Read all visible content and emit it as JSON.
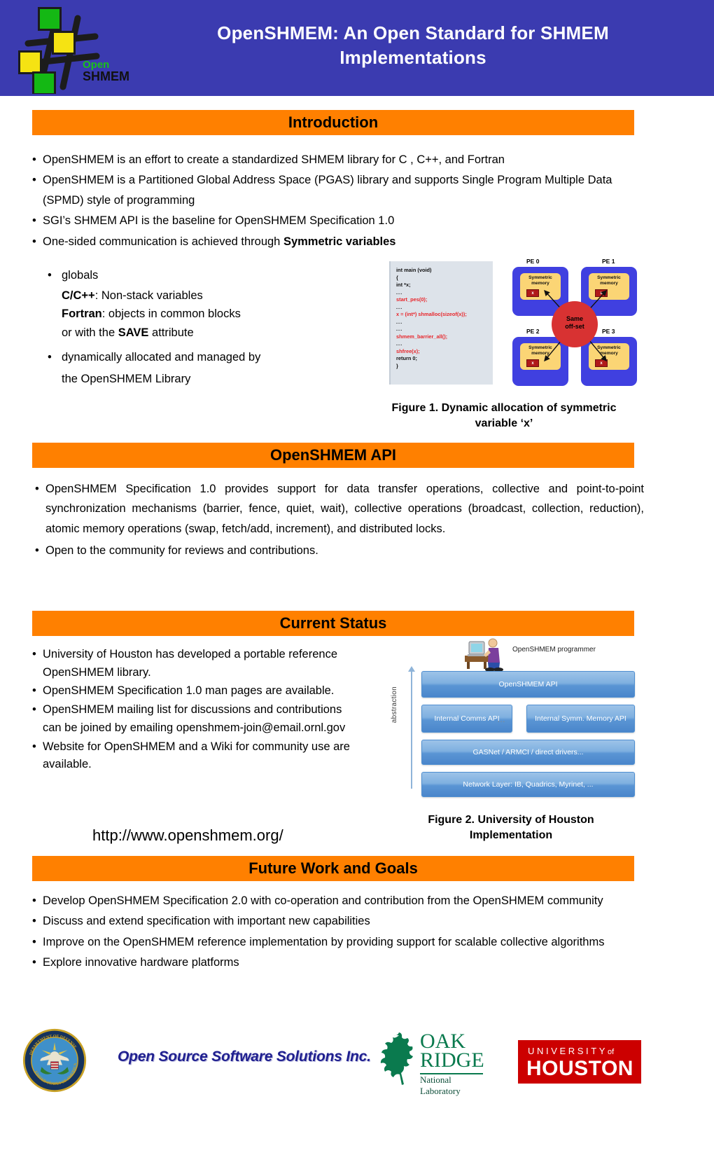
{
  "header": {
    "title_line1": "OpenSHMEM: An Open Standard for SHMEM",
    "title_line2": "Implementations",
    "logo": {
      "word_open": "Open",
      "word_shmem": "SHMEM"
    },
    "background_color": "#3b3bb0"
  },
  "accent_color": "#ff8000",
  "sections": {
    "introduction": {
      "banner": "Introduction",
      "bullets": [
        "OpenSHMEM is an effort to create a standardized SHMEM library for C , C++, and Fortran",
        "OpenSHMEM is a Partitioned Global Address Space (PGAS) library and supports Single Program Multiple Data (SPMD) style of programming",
        "SGI’s SHMEM API is the baseline for OpenSHMEM Specification 1.0"
      ],
      "bullet4_prefix": "One-sided communication is achieved through ",
      "bullet4_bold": "Symmetric variables",
      "sub": {
        "item1": "globals",
        "line_cc_bold": "C/C++",
        "line_cc_rest": ":  Non-stack variables",
        "line_fortran_bold": "Fortran",
        "line_fortran_rest": ": objects in common blocks",
        "line_save_pre": "or with the ",
        "line_save_bold": "SAVE",
        "line_save_post": " attribute",
        "item2_line1": "dynamically allocated and managed by",
        "item2_line2": "the OpenSHMEM Library"
      }
    },
    "api": {
      "banner": "OpenSHMEM API",
      "bullets": [
        "OpenSHMEM Specification 1.0 provides support for data transfer operations, collective and point-to-point synchronization mechanisms (barrier, fence, quiet, wait),    collective operations (broadcast, collection, reduction), atomic memory operations (swap, fetch/add, increment), and distributed locks.",
        "Open to the community for reviews and contributions."
      ]
    },
    "status": {
      "banner": "Current Status",
      "bullets": [
        "University of Houston has developed a portable reference OpenSHMEM library.",
        "OpenSHMEM Specification 1.0 man pages are available.",
        "OpenSHMEM mailing list  for discussions and contributions can be joined by emailing openshmem-join@email.ornl.gov",
        "Website for OpenSHMEM and a Wiki  for community use are available."
      ],
      "url": "http://www.openshmem.org/"
    },
    "future": {
      "banner": "Future Work and Goals",
      "bullets": [
        "Develop OpenSHMEM Specification 2.0 with co-operation and contribution from the OpenSHMEM community",
        "Discuss and extend specification with important new capabilities",
        "Improve on the OpenSHMEM reference implementation by providing support for scalable collective algorithms",
        "Explore innovative hardware platforms"
      ]
    }
  },
  "figure1": {
    "caption_line1": "Figure 1.  Dynamic allocation of symmetric",
    "caption_line2": "variable ‘x’",
    "code_lines": [
      {
        "text": "int main (void)",
        "color": "black"
      },
      {
        "text": "{",
        "color": "black"
      },
      {
        "text": "int *x;",
        "color": "black"
      },
      {
        "text": "...",
        "color": "black"
      },
      {
        "text": "start_pes(0);",
        "color": "red"
      },
      {
        "text": "...",
        "color": "black"
      },
      {
        "text": "x = (int*) shmalloc(sizeof(x));",
        "color": "red"
      },
      {
        "text": "...",
        "color": "black"
      },
      {
        "text": "...",
        "color": "black"
      },
      {
        "text": "shmem_barrier_all();",
        "color": "red"
      },
      {
        "text": "...",
        "color": "black"
      },
      {
        "text": "shfree(x);",
        "color": "red"
      },
      {
        "text": "return  0;",
        "color": "black"
      },
      {
        "text": "}",
        "color": "black"
      }
    ],
    "pe_labels": [
      "PE 0",
      "PE 1",
      "PE 2",
      "PE 3"
    ],
    "symmetric_memory_label_l1": "Symmetric",
    "symmetric_memory_label_l2": "memory",
    "variable_cell": "x",
    "center_label_l1": "Same",
    "center_label_l2": "off-set"
  },
  "figure2": {
    "caption_line1": "Figure 2. University of Houston",
    "caption_line2": "Implementation",
    "programmer_label": "OpenSHMEM programmer",
    "axis_label": "abstraction",
    "layers": [
      "OpenSHMEM API",
      "Internal Comms API",
      "Internal Symm. Memory API",
      "GASNet / ARMCI / direct drivers...",
      "Network Layer: IB, Quadrics, Myrinet, ..."
    ],
    "separator": "…"
  },
  "footer": {
    "oss_text": "Open Source Software Solutions Inc.",
    "ornl": {
      "oak": "OAK",
      "ridge": "RIDGE",
      "national_lab": "National Laboratory"
    },
    "uh": {
      "university": "UNIVERSITY",
      "of": "of",
      "houston": "HOUSTON"
    },
    "dod": {
      "top_text": "DEPARTMENT OF DEFENSE",
      "bottom_text": "UNITED STATES OF AMERICA"
    }
  }
}
